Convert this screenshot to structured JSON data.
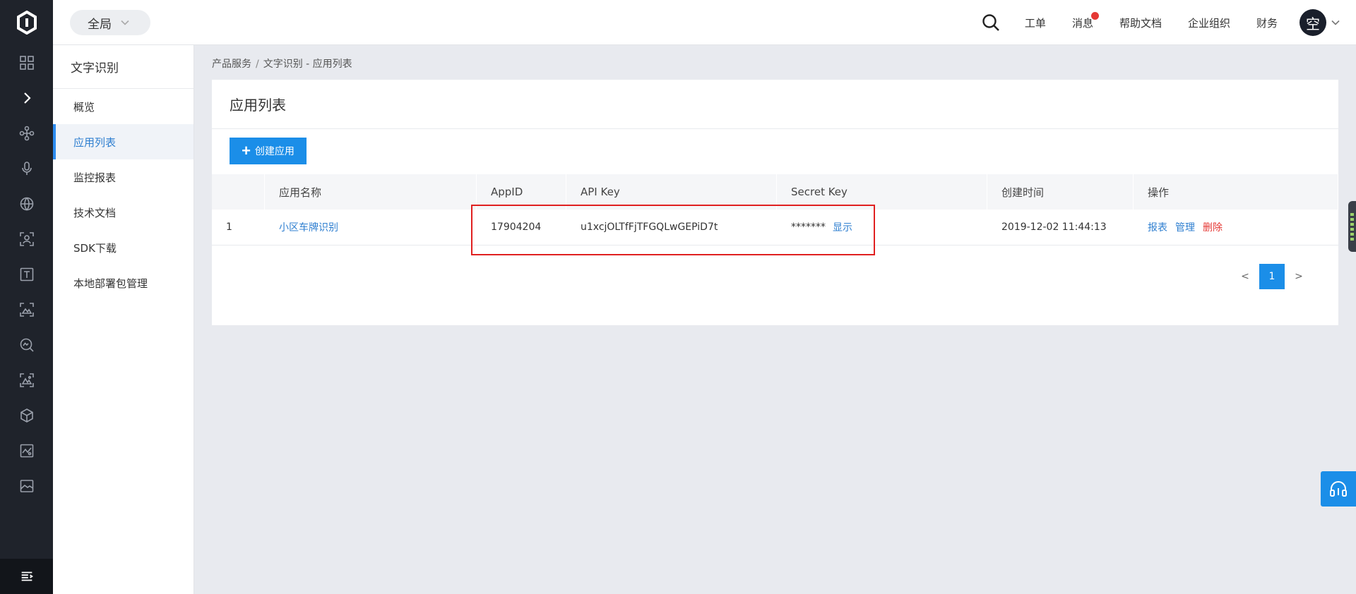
{
  "colors": {
    "rail": "#1f232b",
    "accent": "#1b8ee8",
    "link": "#2f7fd0",
    "danger": "#e53935",
    "highlight": "#e02020"
  },
  "topbar": {
    "scope": "全局",
    "nav": [
      "工单",
      "消息",
      "帮助文档",
      "企业组织",
      "财务"
    ],
    "avatar": "空"
  },
  "rail": {
    "icons": [
      "dashboard-icon",
      "expand-chevron-icon",
      "network-icon",
      "microphone-icon",
      "globe-icon",
      "face-scan-icon",
      "text-icon",
      "image-scan-icon",
      "image-search-icon",
      "image-scan-alt-icon",
      "cube-icon",
      "image-chart-icon",
      "image-landscape-icon"
    ],
    "bottom_icon": "menu-collapse-icon"
  },
  "sidebar": {
    "title": "文字识别",
    "items": [
      "概览",
      "应用列表",
      "监控报表",
      "技术文档",
      "SDK下载",
      "本地部署包管理"
    ],
    "active_index": 1
  },
  "breadcrumb": {
    "part1": "产品服务",
    "sep": "/",
    "part2": "文字识别 - 应用列表"
  },
  "panel": {
    "title": "应用列表",
    "create_button": "创建应用",
    "columns": [
      "",
      "应用名称",
      "AppID",
      "API Key",
      "Secret Key",
      "创建时间",
      "操作"
    ],
    "row": {
      "index": "1",
      "name": "小区车牌识别",
      "app_id": "17904204",
      "api_key": "u1xcjOLTfFjTFGQLwGEPiD7t",
      "secret_masked": "*******",
      "secret_show": "显示",
      "created": "2019-12-02 11:44:13",
      "ops": [
        "报表",
        "管理",
        "删除"
      ]
    }
  },
  "pagination": {
    "prev": "<",
    "current": "1",
    "next": ">"
  }
}
